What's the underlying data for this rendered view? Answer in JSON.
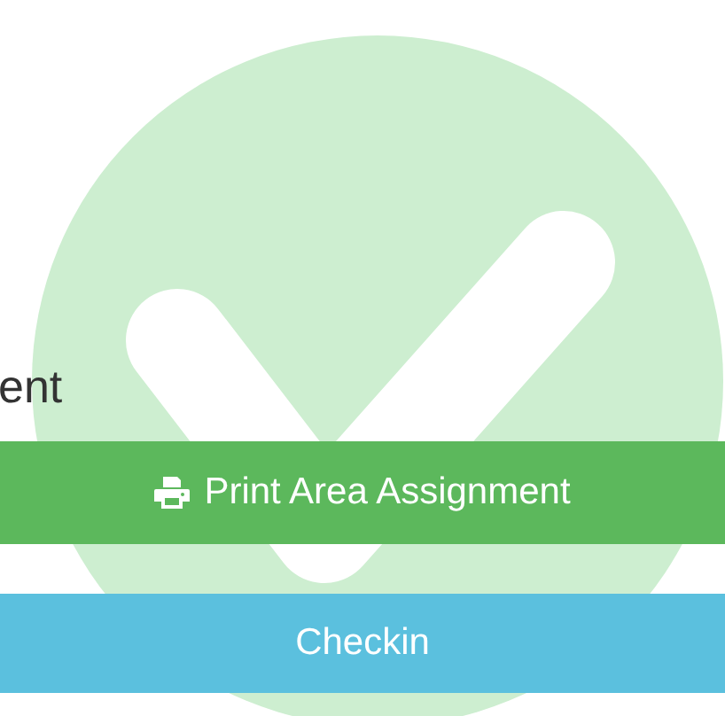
{
  "label_fragment": "ent",
  "buttons": [
    {
      "kind": "print",
      "label": "Print Area Assignment"
    },
    {
      "kind": "plain",
      "label": "Checkin"
    }
  ]
}
